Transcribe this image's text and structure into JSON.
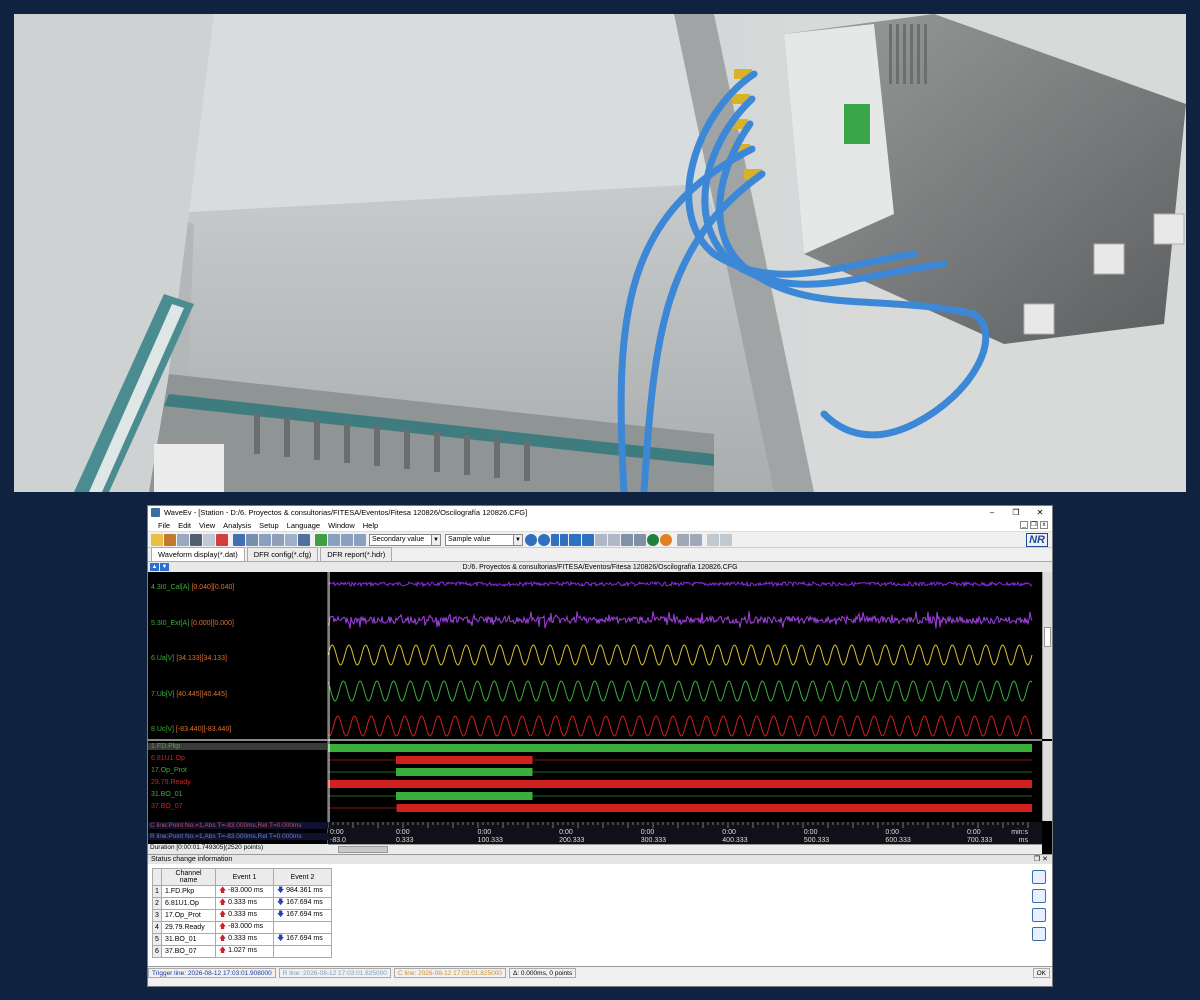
{
  "window": {
    "title": "WaveEv - [Station - D:/6. Proyectos & consultorias/FITESA/Eventos/Fitesa 120826/Oscilografía 120826.CFG]",
    "minimize": "–",
    "maximize": "❐",
    "close": "✕"
  },
  "menu": [
    "File",
    "Edit",
    "View",
    "Analysis",
    "Setup",
    "Language",
    "Window",
    "Help"
  ],
  "toolbar": {
    "value_mode": "Secondary value",
    "sample_mode": "Sample value",
    "logo": "NR"
  },
  "tabs": [
    "Waveform display(*.dat)",
    "DFR config(*.cfg)",
    "DFR report(*.hdr)"
  ],
  "path": "D:/6. Proyectos & consultorias/FITESA/Eventos/Fitesa 120826/Oscilografía 120826.CFG",
  "analog_channels": [
    {
      "name": "4.3I0_Cal[A]",
      "value": "[0.040][0.040]",
      "color": "#3ab03a"
    },
    {
      "name": "5.3I0_Ext[A]",
      "value": "[0.000][0.000]",
      "color": "#3ab03a"
    },
    {
      "name": "6.Ua[V]",
      "value": "[34.133][34.133]",
      "color": "#3ab03a"
    },
    {
      "name": "7.Ub[V]",
      "value": "[40.445][40.445]",
      "color": "#3ab03a"
    },
    {
      "name": "8.Uc[V]",
      "value": "[-83.440][-83.440]",
      "color": "#3ab03a"
    }
  ],
  "digital_channels": [
    {
      "name": "1.FD.Pkp",
      "color": "#3ab03a"
    },
    {
      "name": "6.81U1.Op",
      "color": "#d02020"
    },
    {
      "name": "17.Op_Prot",
      "color": "#3ab03a"
    },
    {
      "name": "29.79.Ready",
      "color": "#d02020"
    },
    {
      "name": "31.BO_01",
      "color": "#3ab03a"
    },
    {
      "name": "37.BO_07",
      "color": "#d02020"
    }
  ],
  "cursor_info": {
    "c_line": "C line:Point No.=1,Abs T=-83.000ms,Rel T=0.000ms",
    "r_line": "R line:Point No.=1,Abs T=-83.000ms,Rel T=0.000ms",
    "duration": "Duration [0:00:01.749305](2520 points)"
  },
  "time_axis": {
    "top": [
      "0:00",
      "0:00",
      "0:00",
      "0:00",
      "0:00",
      "0:00",
      "0:00",
      "0:00",
      "0:00"
    ],
    "bottom": [
      "-83.0",
      "0.333",
      "100.333",
      "200.333",
      "300.333",
      "400.333",
      "500.333",
      "600.333",
      "700.333"
    ],
    "unit_top": "min:s",
    "unit_bottom": "ms"
  },
  "status_panel": {
    "title": "Status change information",
    "headers": [
      "Channel name",
      "Event 1",
      "Event 2"
    ],
    "rows": [
      {
        "idx": "1",
        "name": "1.FD.Pkp",
        "e1": "-83.000 ms",
        "e1dir": "up",
        "e2": "984.361 ms",
        "e2dir": "down"
      },
      {
        "idx": "2",
        "name": "6.81U1.Op",
        "e1": "0.333 ms",
        "e1dir": "up",
        "e2": "167.694 ms",
        "e2dir": "down"
      },
      {
        "idx": "3",
        "name": "17.Op_Prot",
        "e1": "0.333 ms",
        "e1dir": "up",
        "e2": "167.694 ms",
        "e2dir": "down"
      },
      {
        "idx": "4",
        "name": "29.79.Ready",
        "e1": "-83.000 ms",
        "e1dir": "up",
        "e2": "",
        "e2dir": ""
      },
      {
        "idx": "5",
        "name": "31.BO_01",
        "e1": "0.333 ms",
        "e1dir": "up",
        "e2": "167.694 ms",
        "e2dir": "down"
      },
      {
        "idx": "6",
        "name": "37.BO_07",
        "e1": "1.027 ms",
        "e1dir": "up",
        "e2": "",
        "e2dir": ""
      }
    ]
  },
  "statusbar": {
    "trigger": "Trigger line: 2026-08-12 17:03:01.908000",
    "rline": "R line: 2026-08-12 17:03:01.825000",
    "cline": "C line: 2026-08-12 17:03:01.825000",
    "delta": "Δ: 0.000ms, 0 points",
    "ok": "OK"
  }
}
